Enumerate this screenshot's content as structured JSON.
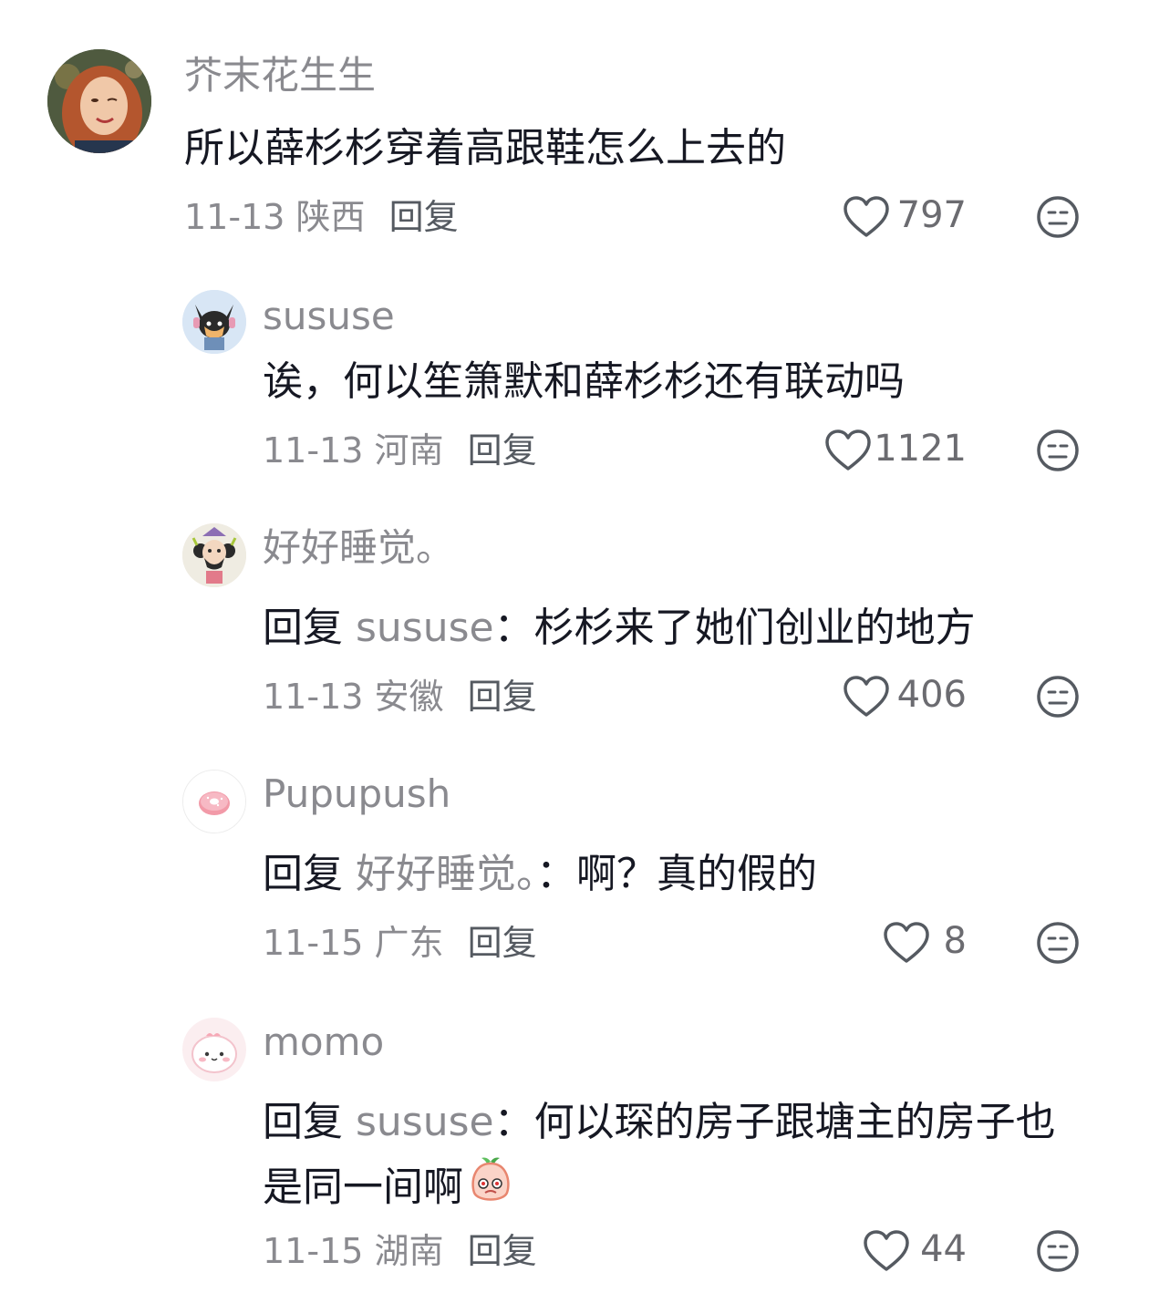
{
  "comments": [
    {
      "username": "芥末花生生",
      "text": "所以薛杉杉穿着高跟鞋怎么上去的",
      "date": "11-13",
      "location": "陕西",
      "reply_label": "回复",
      "likes": "797"
    },
    {
      "username": "sususe",
      "text": "诶，何以笙箫默和薛杉杉还有联动吗",
      "date": "11-13",
      "location": "河南",
      "reply_label": "回复",
      "likes": "1121"
    },
    {
      "username": "好好睡觉。",
      "reply_prefix": "回复",
      "reply_to": "sususe",
      "separator": "：",
      "text": "杉杉来了她们创业的地方",
      "date": "11-13",
      "location": "安徽",
      "reply_label": "回复",
      "likes": "406"
    },
    {
      "username": "Pupupush",
      "reply_prefix": "回复",
      "reply_to": "好好睡觉。",
      "separator": "：",
      "text": "啊？真的假的",
      "date": "11-15",
      "location": "广东",
      "reply_label": "回复",
      "likes": "8"
    },
    {
      "username": "momo",
      "reply_prefix": "回复",
      "reply_to": "sususe",
      "separator": "：",
      "text": "何以琛的房子跟塘主的房子也是同一间啊",
      "date": "11-15",
      "location": "湖南",
      "reply_label": "回复",
      "likes": "44"
    }
  ],
  "icons": {
    "like": "heart-outline-icon",
    "dislike": "meh-face-icon",
    "emoji": "peach-emoji-icon"
  },
  "colors": {
    "text": "#161823",
    "muted": "#8a8a8f",
    "icon": "#555a61"
  }
}
